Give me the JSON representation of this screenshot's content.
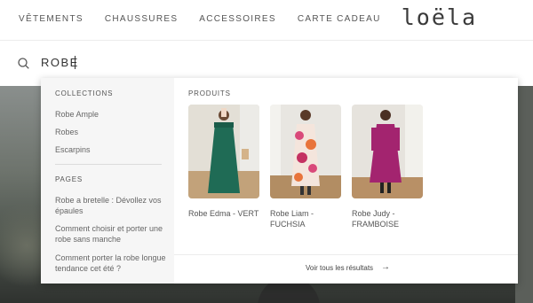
{
  "nav": {
    "items": [
      "VÊTEMENTS",
      "CHAUSSURES",
      "ACCESSOIRES",
      "CARTE CADEAU"
    ],
    "logo": "loëla"
  },
  "search": {
    "value": "ROBE",
    "icon": "search-icon"
  },
  "dropdown": {
    "collections_title": "COLLECTIONS",
    "collections": [
      "Robe Ample",
      "Robes",
      "Escarpins"
    ],
    "pages_title": "PAGES",
    "pages": [
      "Robe a bretelle : Dévollez vos épaules",
      "Comment choisir et porter une robe sans manche",
      "Comment porter la robe longue tendance cet été ?"
    ],
    "products_title": "PRODUITS",
    "products": [
      {
        "name": "Robe Edma - VERT",
        "color": "#1f6b55"
      },
      {
        "name": "Robe Liam - FUCHSIA",
        "color": "#d9497a"
      },
      {
        "name": "Robe Judy - FRAMBOISE",
        "color": "#a3246f"
      }
    ],
    "see_all": "Voir tous les résultats"
  }
}
